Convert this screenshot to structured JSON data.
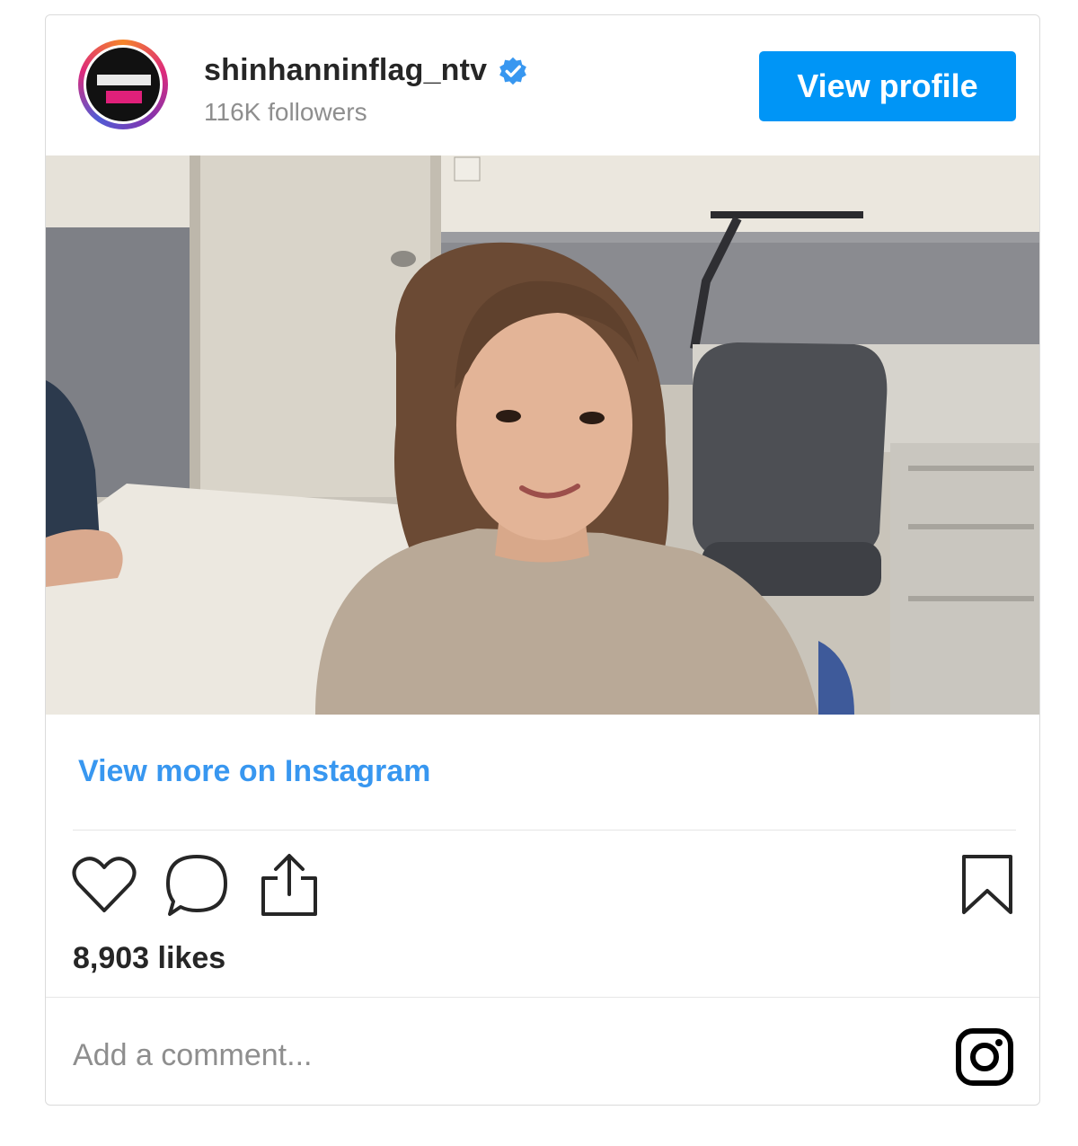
{
  "post": {
    "username": "shinhanninflag_ntv",
    "followers": "116K followers",
    "view_profile_label": "View profile",
    "view_more_label": "View more on Instagram",
    "likes": "8,903 likes",
    "comment_placeholder": "Add a comment..."
  },
  "icons": {
    "verified": "verified-badge-icon",
    "like": "heart-icon",
    "comment": "comment-bubble-icon",
    "share": "share-icon",
    "save": "bookmark-icon",
    "logo": "instagram-logo-icon"
  },
  "colors": {
    "accent": "#0095f6",
    "link": "#3897f0",
    "username": "#262626",
    "muted": "#8e8e8e"
  }
}
